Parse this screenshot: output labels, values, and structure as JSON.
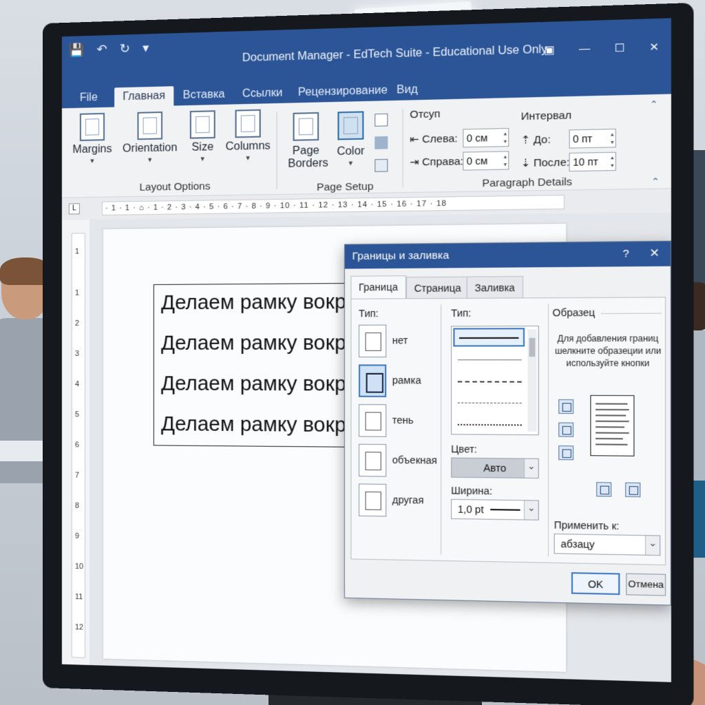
{
  "window": {
    "title": "Document Manager - EdTech Suite - Educational Use Only"
  },
  "quick_access": {
    "save_icon": "save-icon",
    "undo_icon": "undo-icon",
    "redo_icon": "redo-icon",
    "customize_icon": "customize-qat-icon"
  },
  "tabs": [
    "File",
    "Главная",
    "Вставка",
    "Ссылки",
    "Рецензирование",
    "Вид"
  ],
  "ribbon": {
    "layout": {
      "margins": "Margins",
      "orientation": "Orientation",
      "size": "Size",
      "columns": "Columns",
      "group_label": "Layout Options"
    },
    "page_setup": {
      "page_borders_line1": "Page",
      "page_borders_line2": "Borders",
      "color": "Color",
      "group_label": "Page Setup"
    },
    "paragraph": {
      "indent_label": "Отсуп",
      "left_label": "Слева:",
      "left_value": "0 см",
      "right_label": "Справа:",
      "right_value": "0 см",
      "spacing_label": "Интервал",
      "before_label": "До:",
      "before_value": "0 пт",
      "after_label": "После:",
      "after_value": "10 пт",
      "group_label": "Paragraph Details"
    }
  },
  "ruler": {
    "tab_selector": "L",
    "marks": "· 1 · 1 · ⌂ · 1 · 2 · 3 · 4 · 5 · 6 · 7 · 8 · 9 · 10 · 11 · 12 · 13 · 14 · 15 · 16 · 17 · 18",
    "vertical_marks": [
      "1",
      "1",
      "2",
      "3",
      "4",
      "5",
      "6",
      "7",
      "8",
      "9",
      "10",
      "11",
      "12"
    ]
  },
  "document": {
    "lines": [
      "Делаем рамку вокр",
      "Делаем рамку вокр",
      "Делаем рамку вокр",
      "Делаем рамку вокр"
    ]
  },
  "dialog": {
    "title": "Границы и заливка",
    "help": "?",
    "close": "✕",
    "tabs": [
      "Граница",
      "Страница",
      "Заливка"
    ],
    "setting_label": "Тип:",
    "settings": [
      "нет",
      "рамка",
      "тень",
      "объекная",
      "другая"
    ],
    "style_label": "Тип:",
    "color_label": "Цвет:",
    "color_value": "Авто",
    "width_label": "Ширина:",
    "width_value": "1,0 pt",
    "preview_label": "Образец",
    "preview_hint": "Для добавления границ шелкните образеции или используйте кнопки",
    "apply_label": "Применить к:",
    "apply_value": "абзацу",
    "ok": "OK",
    "cancel": "Отмена"
  }
}
